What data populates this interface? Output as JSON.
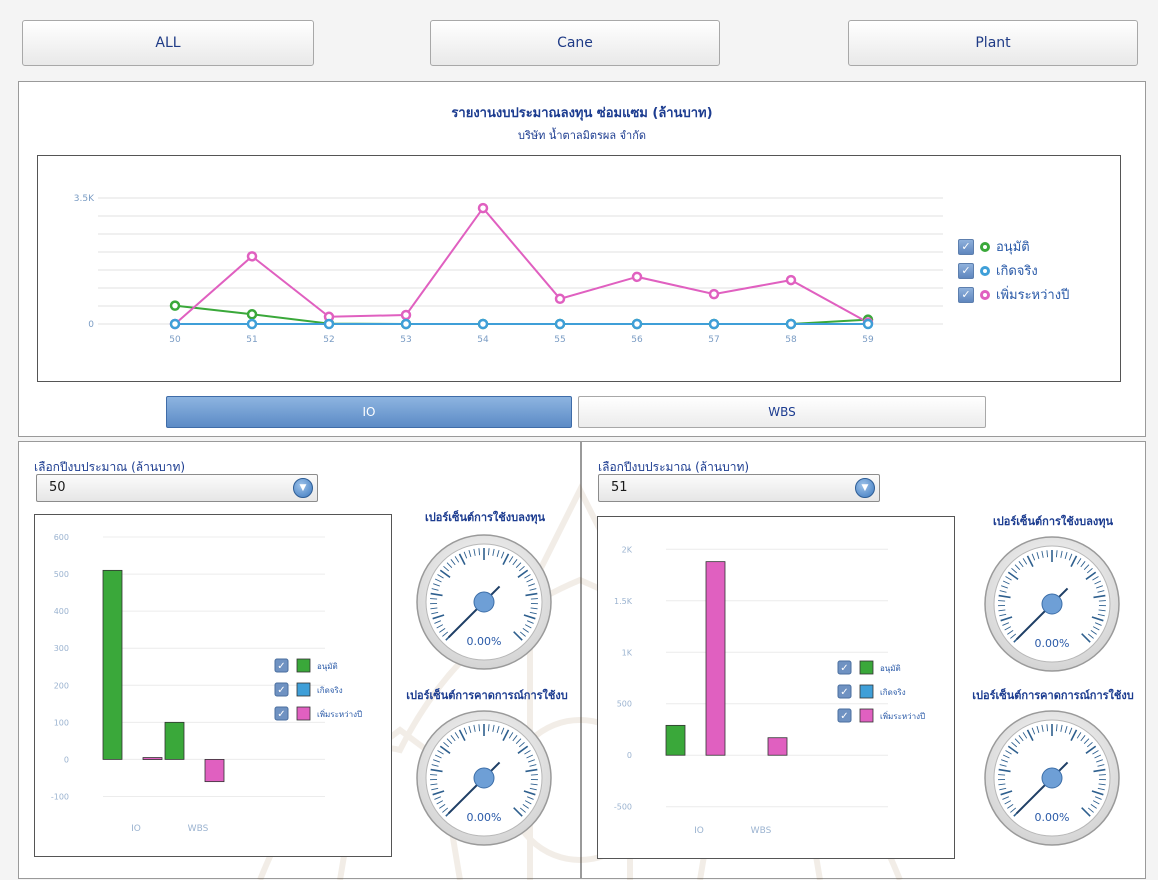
{
  "top_tabs": [
    "ALL",
    "Cane",
    "Plant"
  ],
  "main_chart": {
    "title": "รายงานงบประมาณลงทุน ซ่อมแซม (ล้านบาท)",
    "subtitle": "บริษัท น้ำตาลมิตรผล จำกัด",
    "legend": [
      "อนุมัติ",
      "เกิดจริง",
      "เพิ่มระหว่างปี"
    ],
    "colors": {
      "approved": "#3aa83a",
      "actual": "#3f9fd8",
      "added": "#e060c0"
    }
  },
  "toggle": {
    "io_label": "IO",
    "wbs_label": "WBS"
  },
  "left_panel": {
    "select_label": "เลือกปีงบประมาณ (ล้านบาท)",
    "select_value": "50",
    "legend": [
      "อนุมัติ",
      "เกิดจริง",
      "เพิ่มระหว่างปี"
    ],
    "gauge1_title": "เปอร์เซ็นต์การใช้งบลงทุน",
    "gauge1_value": "0.00%",
    "gauge2_title": "เปอร์เซ็นต์การคาดการณ์การใช้งบ",
    "gauge2_value": "0.00%"
  },
  "right_panel": {
    "select_label": "เลือกปีงบประมาณ (ล้านบาท)",
    "select_value": "51",
    "legend": [
      "อนุมัติ",
      "เกิดจริง",
      "เพิ่มระหว่างปี"
    ],
    "gauge1_title": "เปอร์เซ็นต์การใช้งบลงทุน",
    "gauge1_value": "0.00%",
    "gauge2_title": "เปอร์เซ็นต์การคาดการณ์การใช้งบ",
    "gauge2_value": "0.00%"
  },
  "chart_data": [
    {
      "type": "line",
      "title": "รายงานงบประมาณลงทุน ซ่อมแซม (ล้านบาท)",
      "subtitle": "บริษัท น้ำตาลมิตรผล จำกัด",
      "x": [
        "50",
        "51",
        "52",
        "53",
        "54",
        "55",
        "56",
        "57",
        "58",
        "59"
      ],
      "ytick_labels": [
        "0",
        "3.5K"
      ],
      "ylim": [
        0,
        3500
      ],
      "series": [
        {
          "name": "อนุมัติ",
          "color": "#3aa83a",
          "values": [
            510,
            270,
            10,
            0,
            0,
            0,
            0,
            0,
            0,
            120
          ]
        },
        {
          "name": "เกิดจริง",
          "color": "#3f9fd8",
          "values": [
            0,
            0,
            0,
            0,
            0,
            0,
            0,
            0,
            0,
            0
          ]
        },
        {
          "name": "เพิ่มระหว่างปี",
          "color": "#e060c0",
          "values": [
            0,
            1880,
            200,
            250,
            3220,
            700,
            1310,
            830,
            1220,
            40
          ]
        }
      ],
      "legend_position": "right"
    },
    {
      "type": "bar",
      "categories": [
        "IO",
        "WBS"
      ],
      "ylim": [
        -150,
        600
      ],
      "yticks": [
        -100,
        0,
        100,
        200,
        300,
        400,
        500,
        600
      ],
      "series": [
        {
          "name": "อนุมัติ",
          "color": "#3aa83a",
          "values": [
            510,
            100
          ]
        },
        {
          "name": "เกิดจริง",
          "color": "#3f9fd8",
          "values": [
            0,
            0
          ]
        },
        {
          "name": "เพิ่มระหว่างปี",
          "color": "#e060c0",
          "values": [
            5,
            -60
          ]
        }
      ],
      "legend_position": "right"
    },
    {
      "type": "bar",
      "categories": [
        "IO",
        "WBS"
      ],
      "ylim": [
        -600,
        2100
      ],
      "yticks": [
        -500,
        0,
        500,
        1000,
        1500,
        2000
      ],
      "ytick_labels": [
        "-500",
        "0",
        "500",
        "1K",
        "1.5K",
        "2K"
      ],
      "series": [
        {
          "name": "อนุมัติ",
          "color": "#3aa83a",
          "values": [
            290,
            0
          ]
        },
        {
          "name": "เกิดจริง",
          "color": "#3f9fd8",
          "values": [
            0,
            0
          ]
        },
        {
          "name": "เพิ่มระหว่างปี",
          "color": "#e060c0",
          "values": [
            1880,
            170
          ]
        }
      ],
      "legend_position": "right"
    }
  ]
}
